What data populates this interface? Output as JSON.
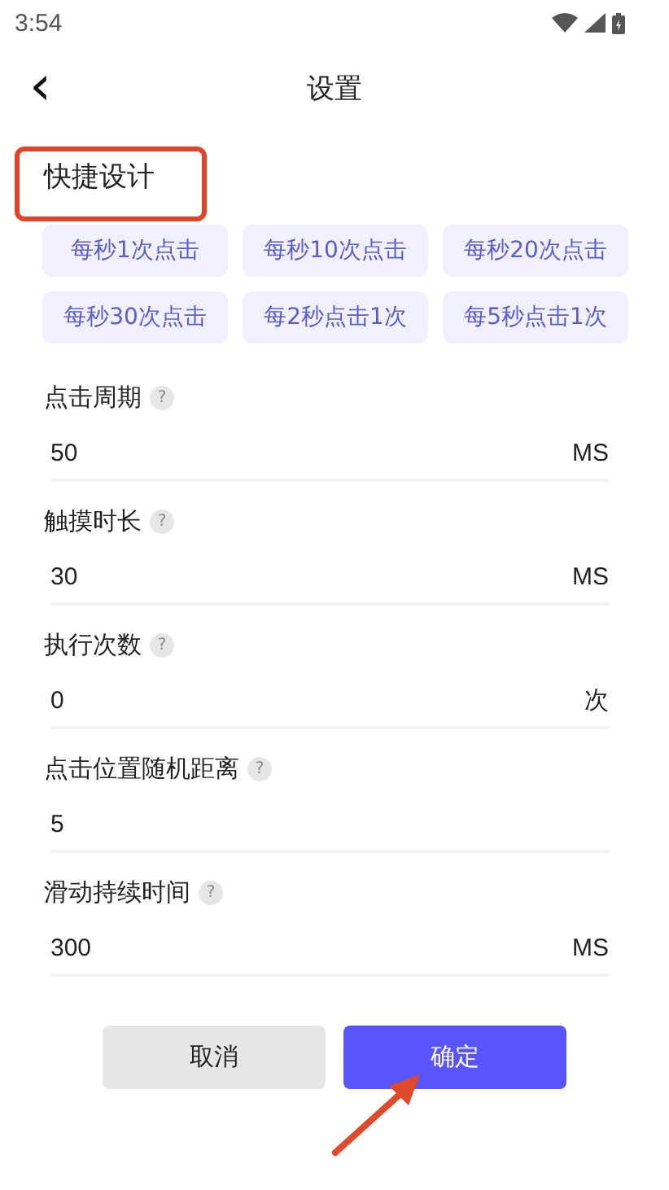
{
  "status_bar": {
    "time": "3:54"
  },
  "header": {
    "back": "‹",
    "title": "设置"
  },
  "section": {
    "title": "快捷设计"
  },
  "presets": [
    {
      "label": "每秒1次点击"
    },
    {
      "label": "每秒10次点击"
    },
    {
      "label": "每秒20次点击"
    },
    {
      "label": "每秒30次点击"
    },
    {
      "label": "每2秒点击1次"
    },
    {
      "label": "每5秒点击1次"
    }
  ],
  "fields": [
    {
      "label": "点击周期",
      "help": "?",
      "value": "50",
      "unit": "MS"
    },
    {
      "label": "触摸时长",
      "help": "?",
      "value": "30",
      "unit": "MS"
    },
    {
      "label": "执行次数",
      "help": "?",
      "value": "0",
      "unit": "次"
    },
    {
      "label": "点击位置随机距离",
      "help": "?",
      "value": "5"
    },
    {
      "label": "滑动持续时间",
      "help": "?",
      "value": "300",
      "unit": "MS"
    }
  ],
  "buttons": [
    {
      "label": "取消",
      "kind": "secondary"
    },
    {
      "label": "确定",
      "kind": "primary"
    }
  ]
}
